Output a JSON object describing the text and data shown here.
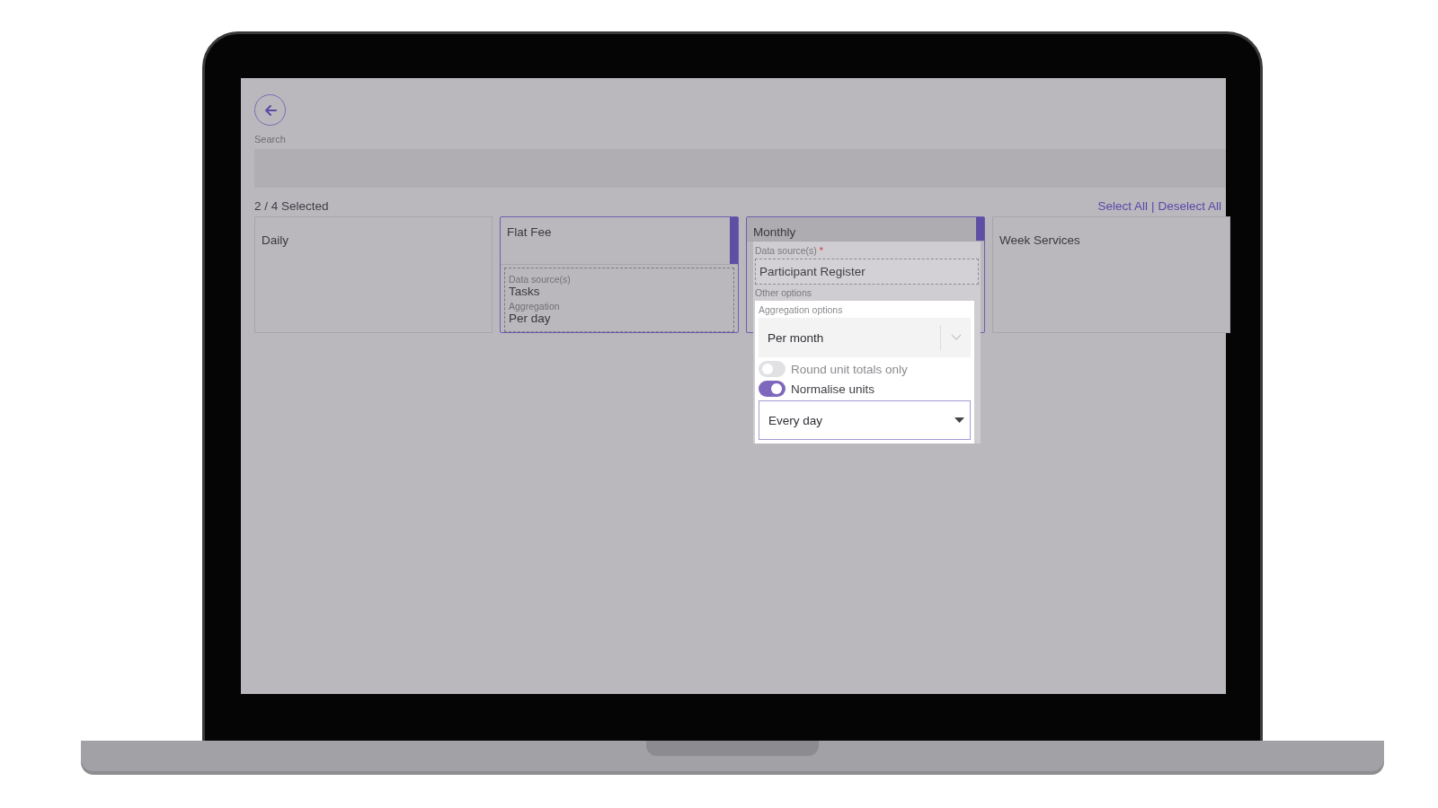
{
  "search": {
    "label": "Search"
  },
  "selection": {
    "count": "2 / 4 Selected",
    "links": [
      "Select All",
      "Deselect All"
    ],
    "separator": "|"
  },
  "cards": [
    {
      "title": "Daily",
      "selected": false
    },
    {
      "title": "Flat Fee",
      "selected": true,
      "details": [
        {
          "label": "Data source(s)",
          "value": "Tasks"
        },
        {
          "label": "Aggregation",
          "value": "Per day"
        }
      ]
    },
    {
      "title": "Monthly",
      "selected": true,
      "editor": {
        "data_source_label": "Data source(s)",
        "required_mark": "*",
        "data_source_value": "Participant Register",
        "other_options_label": "Other options",
        "aggregation_label": "Aggregation options",
        "aggregation_value": "Per month",
        "toggles": [
          {
            "label": "Round unit totals only",
            "on": false
          },
          {
            "label": "Normalise units",
            "on": true
          }
        ],
        "frequency_value": "Every day"
      }
    },
    {
      "title": "Week Services",
      "selected": false
    }
  ]
}
